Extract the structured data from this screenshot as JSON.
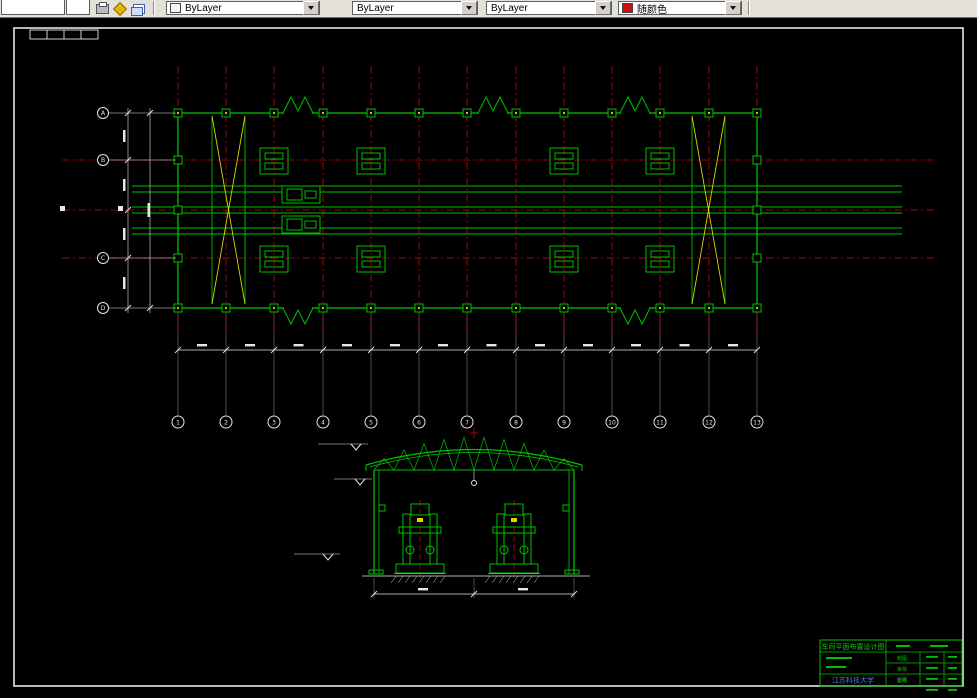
{
  "toolbar": {
    "color_combo": {
      "value": "ByLayer",
      "swatch_color": "#f2f2f2"
    },
    "linetype_combo": {
      "value": "ByLayer"
    },
    "lineweight_combo": {
      "value": "ByLayer"
    },
    "plotstyle_combo": {
      "value": "随颜色",
      "swatch_color": "#cc1010"
    }
  },
  "drawing": {
    "plan": {
      "row_bubble_labels": [
        "A",
        "B",
        "C",
        "D"
      ],
      "col_bubble_labels": [
        "1",
        "2",
        "3",
        "4",
        "5",
        "6",
        "7",
        "8",
        "9",
        "10",
        "11",
        "12",
        "13"
      ]
    },
    "title_block": {
      "title": "车间平面布置设计图",
      "organization": "江苏科技大学",
      "fields": [
        {
          "label": "制图"
        },
        {
          "label": "审核"
        },
        {
          "label": "比例"
        },
        {
          "label": "图号"
        }
      ]
    },
    "colors": {
      "green": "#00c000",
      "red": "#d40000",
      "yellow": "#d8d800",
      "white": "#e6e6e6",
      "gray": "#9a9a9a",
      "blue_text": "#4a7fe0",
      "background": "#000000"
    }
  }
}
